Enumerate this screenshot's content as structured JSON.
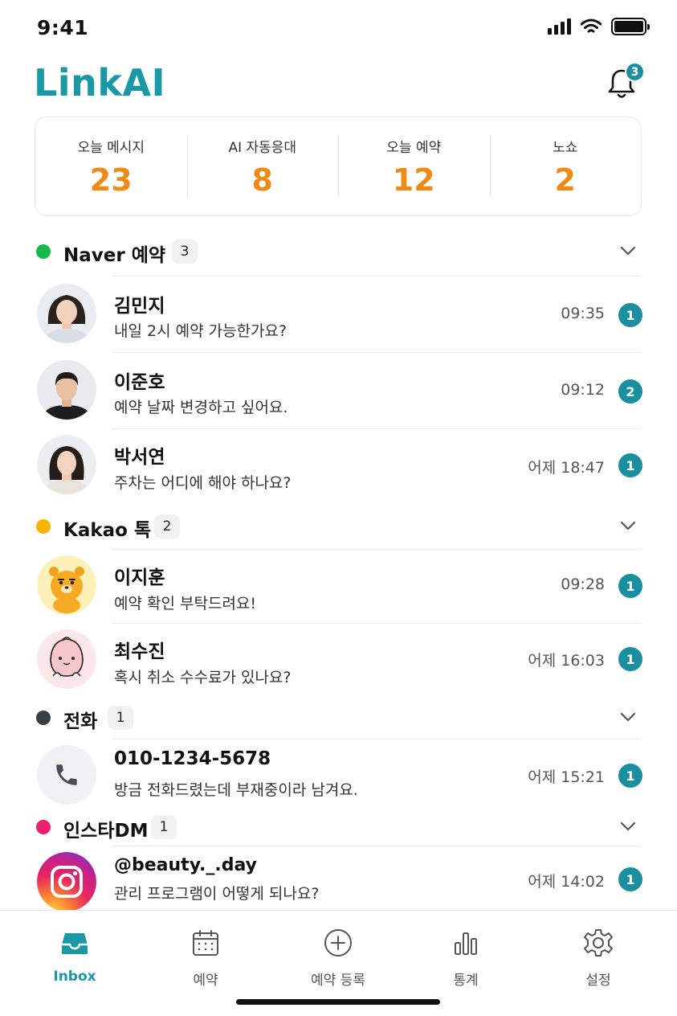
{
  "status": {
    "time": "9:41"
  },
  "app": {
    "title": "LinkAI",
    "notification_count": "3"
  },
  "stats": [
    {
      "label": "오늘 메시지",
      "value": "23"
    },
    {
      "label": "AI 자동응대",
      "value": "8"
    },
    {
      "label": "오늘 예약",
      "value": "12"
    },
    {
      "label": "노쇼",
      "value": "2"
    }
  ],
  "sections": {
    "naver": {
      "title": "Naver 예약",
      "count": "3",
      "color": "#13b94b"
    },
    "kakao": {
      "title": "Kakao 톡",
      "count": "2",
      "color": "#f7b500"
    },
    "phone": {
      "title": "전화",
      "count": "1",
      "color": "#3a3d42"
    },
    "insta": {
      "title": "인스타DM",
      "count": "1",
      "color": "#ef1f6e"
    }
  },
  "messages": {
    "m1": {
      "name": "김민지",
      "text": "내일 2시 예약 가능한가요?",
      "time": "09:35",
      "unread": "1"
    },
    "m2": {
      "name": "이준호",
      "text": "예약 날짜 변경하고 싶어요.",
      "time": "09:12",
      "unread": "2"
    },
    "m3": {
      "name": "박서연",
      "text": "주차는 어디에 해야 하나요?",
      "time": "어제 18:47",
      "unread": "1"
    },
    "m4": {
      "name": "이지훈",
      "text": "예약 확인 부탁드려요!",
      "time": "09:28",
      "unread": "1"
    },
    "m5": {
      "name": "최수진",
      "text": "혹시 취소 수수료가 있나요?",
      "time": "어제 16:03",
      "unread": "1"
    },
    "m6": {
      "name": "010-1234-5678",
      "text": "방금 전화드렸는데 부재중이라 남겨요.",
      "time": "어제 15:21",
      "unread": "1"
    },
    "m7": {
      "name": "@beauty._.day",
      "text": "관리 프로그램이 어떻게 되나요?",
      "time": "어제 14:02",
      "unread": "1"
    }
  },
  "tabs": [
    {
      "label": "Inbox",
      "icon": "inbox-icon"
    },
    {
      "label": "예약",
      "icon": "calendar-icon"
    },
    {
      "label": "예약 등록",
      "icon": "plus-circle-icon"
    },
    {
      "label": "통계",
      "icon": "bar-chart-icon"
    },
    {
      "label": "설정",
      "icon": "gear-icon"
    }
  ],
  "colors": {
    "brand": "#1a98a6",
    "badge": "#1a8fa0",
    "stat_value": "#ef8a16"
  }
}
